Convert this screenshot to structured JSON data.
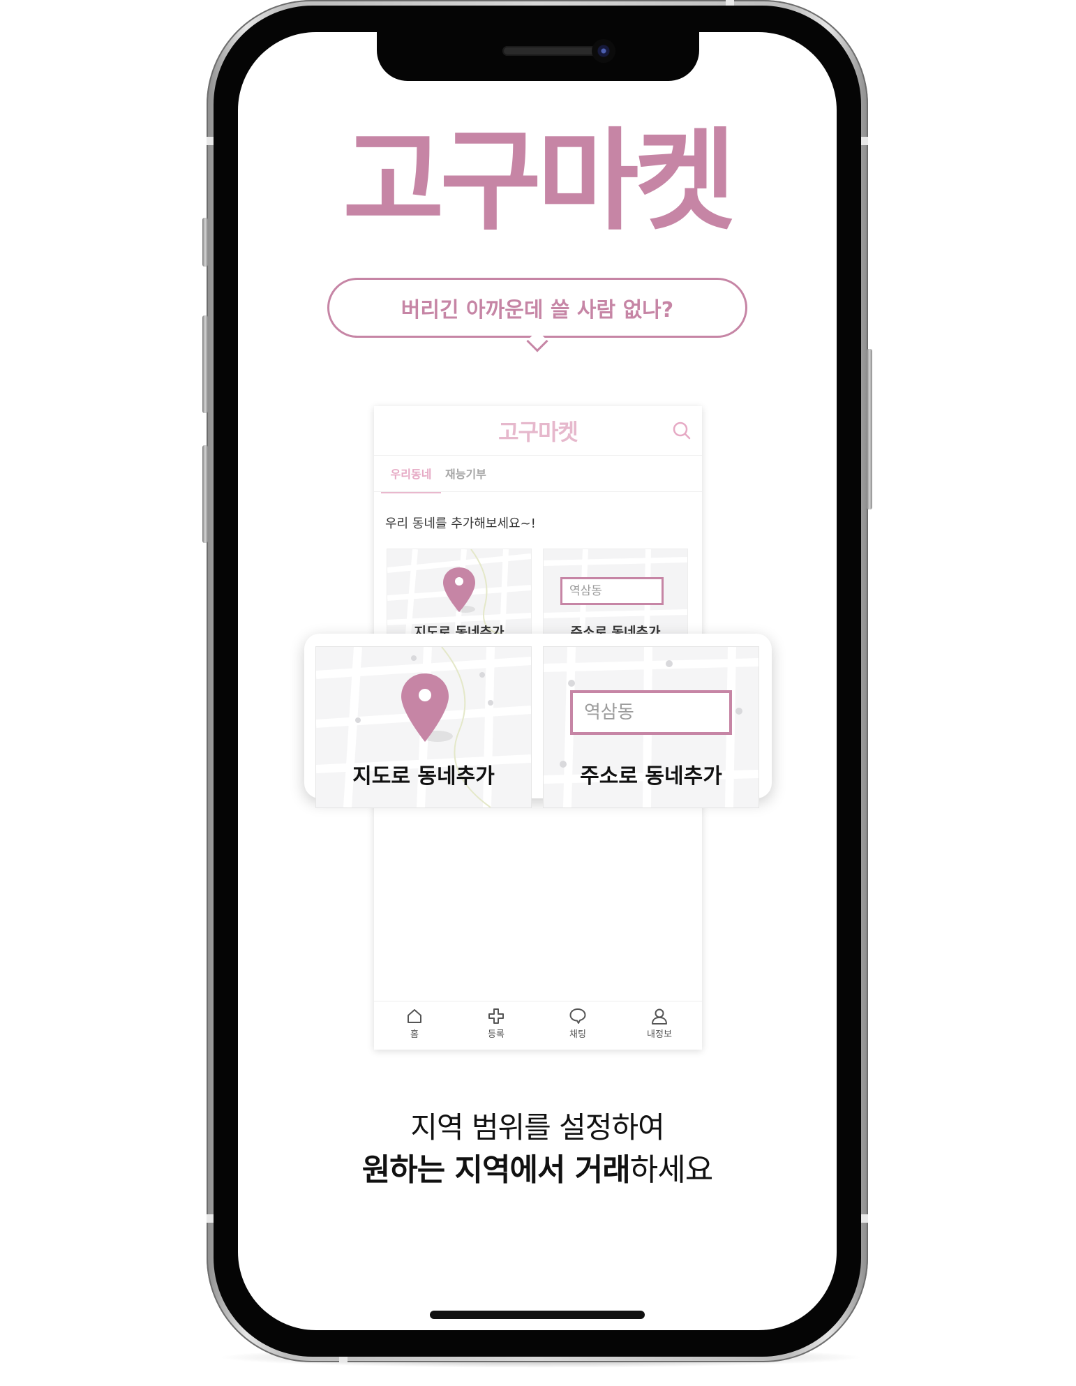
{
  "brand": {
    "title": "고구마켓",
    "tagline": "버리긴 아까운데 쓸 사람 없나?",
    "accent_color": "#c685a5"
  },
  "app": {
    "logo": "고구마켓",
    "search_icon": "search-icon",
    "tabs": [
      {
        "label": "우리동네",
        "active": true
      },
      {
        "label": "재능기부",
        "active": false
      }
    ],
    "prompt": "우리 동네를 추가해보세요~!",
    "cards": [
      {
        "label": "지도로 동네추가",
        "icon": "map-pin-icon"
      },
      {
        "label": "주소로 동네추가",
        "field_value": "역삼동"
      }
    ],
    "nav": [
      {
        "label": "홈",
        "icon": "home-icon"
      },
      {
        "label": "등록",
        "icon": "plus-icon"
      },
      {
        "label": "채팅",
        "icon": "chat-icon"
      },
      {
        "label": "내정보",
        "icon": "user-icon"
      }
    ]
  },
  "popup": {
    "map_card_label": "지도로 동네추가",
    "address_card_label": "주소로 동네추가",
    "address_field_value": "역삼동"
  },
  "copy": {
    "line1": "지역 범위를 설정하여",
    "line2_bold": "원하는 지역에서 거래",
    "line2_rest": "하세요"
  }
}
